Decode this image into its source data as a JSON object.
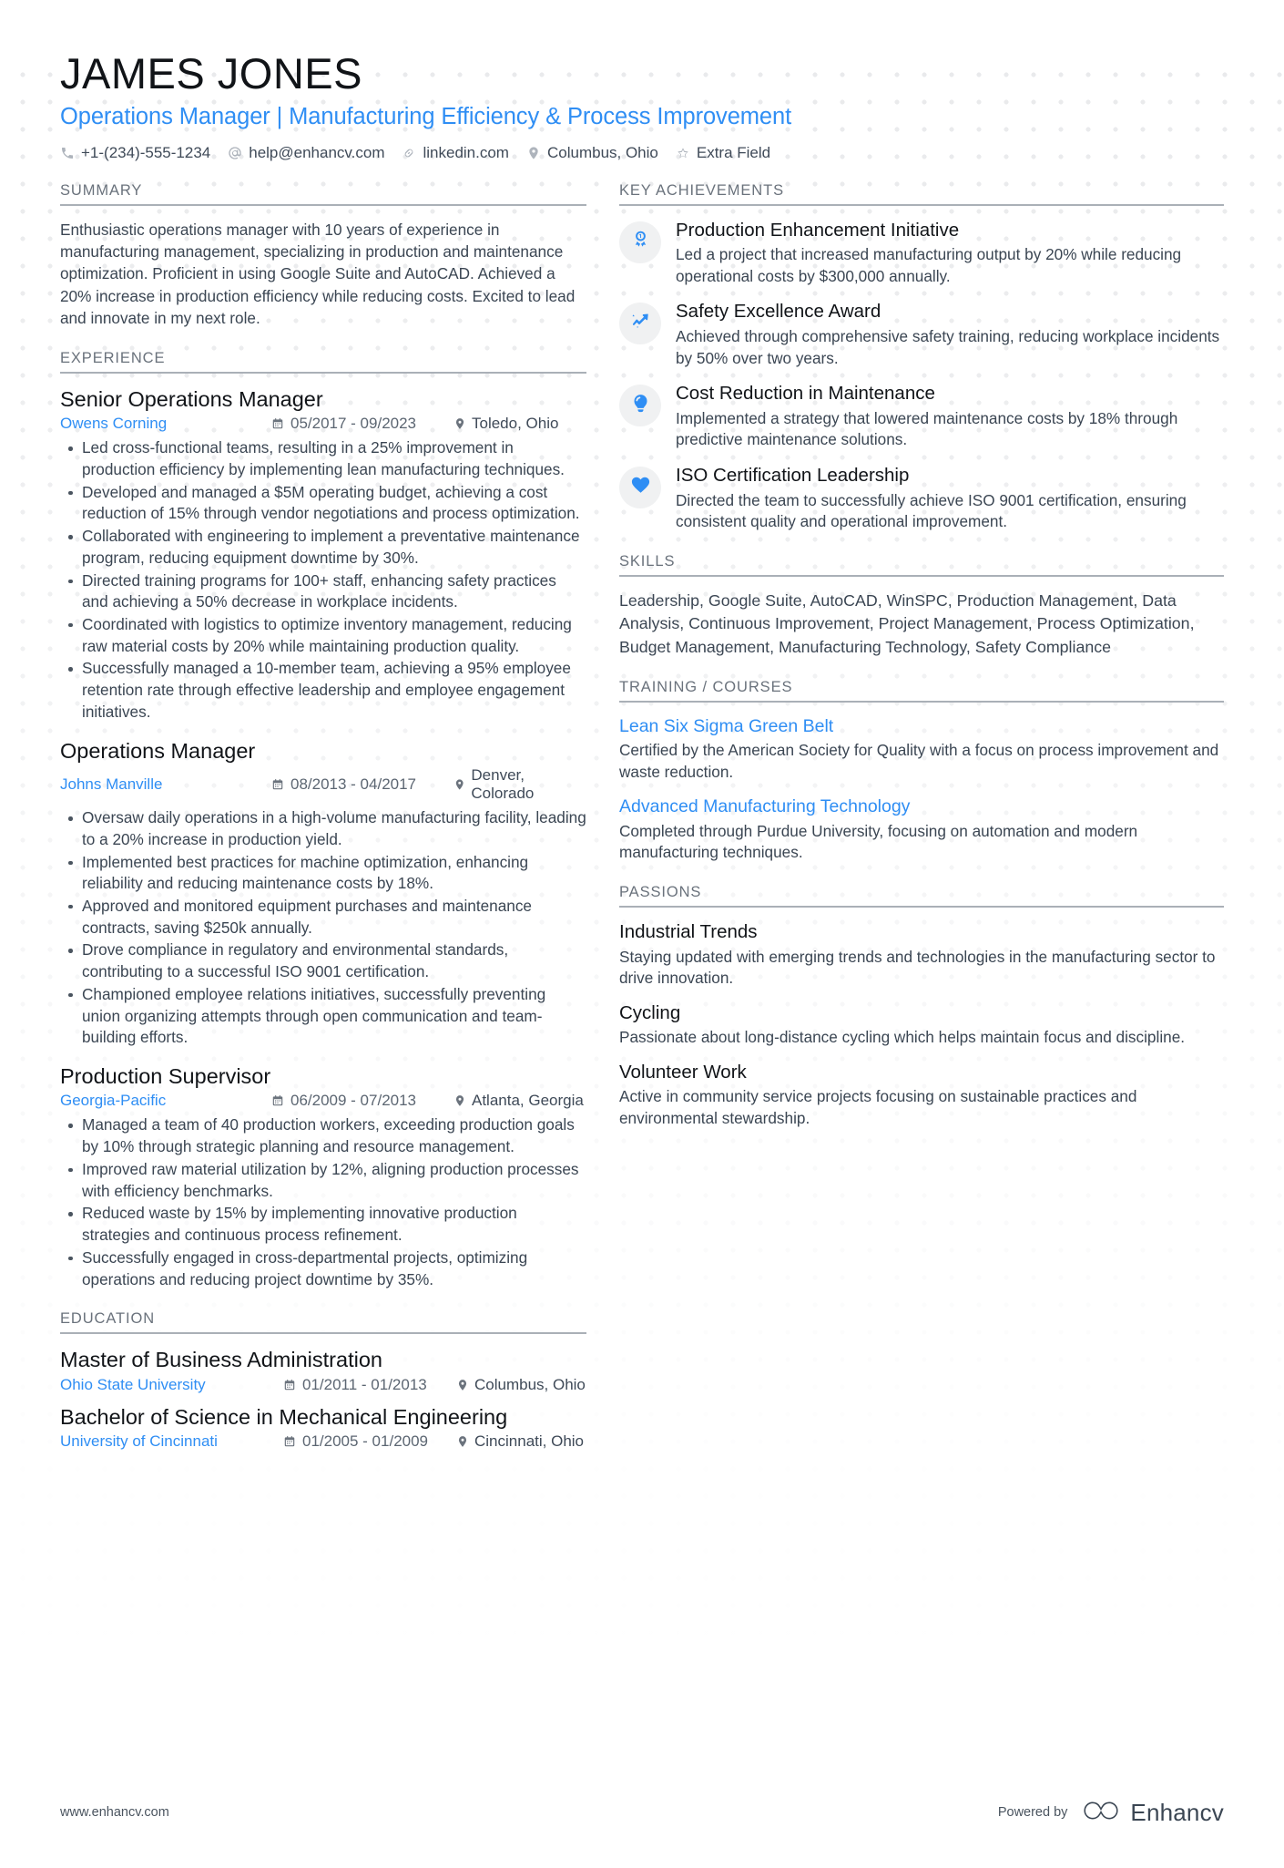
{
  "header": {
    "name": "JAMES JONES",
    "headline": "Operations Manager | Manufacturing Efficiency & Process Improvement",
    "contacts": [
      {
        "icon": "phone-icon",
        "text": "+1-(234)-555-1234"
      },
      {
        "icon": "email-icon",
        "text": "help@enhancv.com"
      },
      {
        "icon": "link-icon",
        "text": "linkedin.com"
      },
      {
        "icon": "location-pin-icon",
        "text": "Columbus, Ohio"
      },
      {
        "icon": "star-icon",
        "text": "Extra Field"
      }
    ]
  },
  "left": {
    "summary": {
      "title": "SUMMARY",
      "text": "Enthusiastic operations manager with 10 years of experience in manufacturing management, specializing in production and maintenance optimization. Proficient in using Google Suite and AutoCAD. Achieved a 20% increase in production efficiency while reducing costs. Excited to lead and innovate in my next role."
    },
    "experience": {
      "title": "EXPERIENCE",
      "jobs": [
        {
          "title": "Senior Operations Manager",
          "company": "Owens Corning",
          "date": "05/2017 - 09/2023",
          "location": "Toledo, Ohio",
          "bullets": [
            "Led cross-functional teams, resulting in a 25% improvement in production efficiency by implementing lean manufacturing techniques.",
            "Developed and managed a $5M operating budget, achieving a cost reduction of 15% through vendor negotiations and process optimization.",
            "Collaborated with engineering to implement a preventative maintenance program, reducing equipment downtime by 30%.",
            "Directed training programs for 100+ staff, enhancing safety practices and achieving a 50% decrease in workplace incidents.",
            "Coordinated with logistics to optimize inventory management, reducing raw material costs by 20% while maintaining production quality.",
            "Successfully managed a 10-member team, achieving a 95% employee retention rate through effective leadership and employee engagement initiatives."
          ]
        },
        {
          "title": "Operations Manager",
          "company": "Johns Manville",
          "date": "08/2013 - 04/2017",
          "location": "Denver, Colorado",
          "bullets": [
            "Oversaw daily operations in a high-volume manufacturing facility, leading to a 20% increase in production yield.",
            "Implemented best practices for machine optimization, enhancing reliability and reducing maintenance costs by 18%.",
            "Approved and monitored equipment purchases and maintenance contracts, saving $250k annually.",
            "Drove compliance in regulatory and environmental standards, contributing to a successful ISO 9001 certification.",
            "Championed employee relations initiatives, successfully preventing union organizing attempts through open communication and team-building efforts."
          ]
        },
        {
          "title": "Production Supervisor",
          "company": "Georgia-Pacific",
          "date": "06/2009 - 07/2013",
          "location": "Atlanta, Georgia",
          "bullets": [
            "Managed a team of 40 production workers, exceeding production goals by 10% through strategic planning and resource management.",
            "Improved raw material utilization by 12%, aligning production processes with efficiency benchmarks.",
            "Reduced waste by 15% by implementing innovative production strategies and continuous process refinement.",
            "Successfully engaged in cross-departmental projects, optimizing operations and reducing project downtime by 35%."
          ]
        }
      ]
    },
    "education": {
      "title": "EDUCATION",
      "items": [
        {
          "degree": "Master of Business Administration",
          "school": "Ohio State University",
          "date": "01/2011 - 01/2013",
          "location": "Columbus, Ohio"
        },
        {
          "degree": "Bachelor of Science in Mechanical Engineering",
          "school": "University of Cincinnati",
          "date": "01/2005 - 01/2009",
          "location": "Cincinnati, Ohio"
        }
      ]
    }
  },
  "right": {
    "achievements": {
      "title": "KEY ACHIEVEMENTS",
      "items": [
        {
          "icon": "award-ribbon-icon",
          "title": "Production Enhancement Initiative",
          "desc": "Led a project that increased manufacturing output by 20% while reducing operational costs by $300,000 annually."
        },
        {
          "icon": "upward-trend-arrow-icon",
          "title": "Safety Excellence Award",
          "desc": "Achieved through comprehensive safety training, reducing workplace incidents by 50% over two years."
        },
        {
          "icon": "lightbulb-idea-icon",
          "title": "Cost Reduction in Maintenance",
          "desc": "Implemented a strategy that lowered maintenance costs by 18% through predictive maintenance solutions."
        },
        {
          "icon": "heart-icon",
          "title": "ISO Certification Leadership",
          "desc": "Directed the team to successfully achieve ISO 9001 certification, ensuring consistent quality and operational improvement."
        }
      ]
    },
    "skills": {
      "title": "SKILLS",
      "text": "Leadership, Google Suite, AutoCAD, WinSPC, Production Management, Data Analysis, Continuous Improvement, Project Management, Process Optimization, Budget Management, Manufacturing Technology, Safety Compliance"
    },
    "training": {
      "title": "TRAINING / COURSES",
      "items": [
        {
          "name": "Lean Six Sigma Green Belt",
          "desc": "Certified by the American Society for Quality with a focus on process improvement and waste reduction."
        },
        {
          "name": "Advanced Manufacturing Technology",
          "desc": "Completed through Purdue University, focusing on automation and modern manufacturing techniques."
        }
      ]
    },
    "passions": {
      "title": "PASSIONS",
      "items": [
        {
          "name": "Industrial Trends",
          "desc": "Staying updated with emerging trends and technologies in the manufacturing sector to drive innovation."
        },
        {
          "name": "Cycling",
          "desc": "Passionate about long-distance cycling which helps maintain focus and discipline."
        },
        {
          "name": "Volunteer Work",
          "desc": "Active in community service projects focusing on sustainable practices and environmental stewardship."
        }
      ]
    }
  },
  "footer": {
    "url": "www.enhancv.com",
    "powered_by": "Powered by",
    "brand": "Enhancv"
  },
  "colors": {
    "accent": "#2f8ef4",
    "heading": "#6a727c",
    "body": "#3b4653",
    "title": "#111418"
  }
}
